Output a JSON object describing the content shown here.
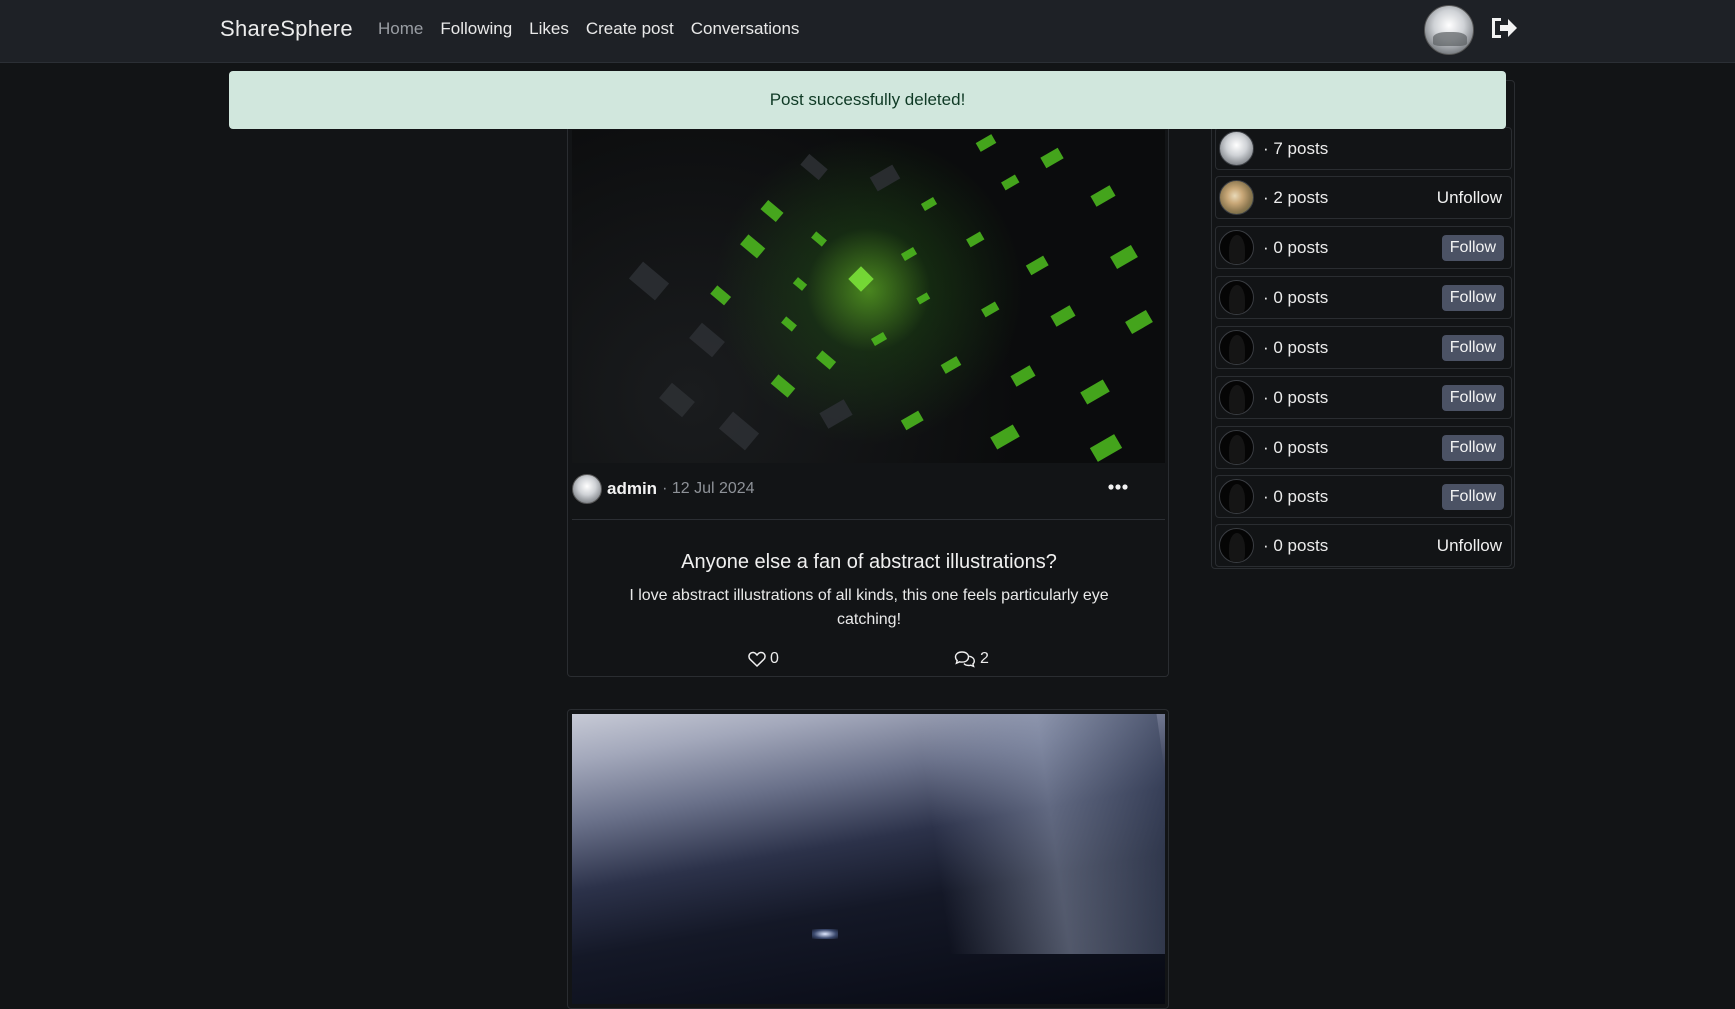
{
  "navbar": {
    "brand": "ShareSphere",
    "links": [
      {
        "label": "Home",
        "active": true
      },
      {
        "label": "Following"
      },
      {
        "label": "Likes"
      },
      {
        "label": "Create post"
      },
      {
        "label": "Conversations"
      }
    ],
    "user_avatar": "admin-avatar",
    "logout_icon": "sign-out-icon"
  },
  "alert": {
    "message": "Post successfully deleted!",
    "color": "#d1e7dd"
  },
  "posts": [
    {
      "image": "green-abstract-cubes",
      "author": "admin",
      "date": "· 12 Jul 2024",
      "title": "Anyone else a fan of abstract illustrations?",
      "body": "I love abstract illustrations of all kinds, this one feels particularly eye catching!",
      "likes": "0",
      "comments": "2"
    },
    {
      "image": "dark-blue-closeup"
    }
  ],
  "sidebar": {
    "users": [
      {
        "posts": "· 7 posts",
        "avatar": "admin",
        "action": ""
      },
      {
        "posts": "· 2 posts",
        "avatar": "cat",
        "action": "Unfollow"
      },
      {
        "posts": "· 0 posts",
        "avatar": "default",
        "action": "Follow"
      },
      {
        "posts": "· 0 posts",
        "avatar": "default",
        "action": "Follow"
      },
      {
        "posts": "· 0 posts",
        "avatar": "default",
        "action": "Follow"
      },
      {
        "posts": "· 0 posts",
        "avatar": "default",
        "action": "Follow"
      },
      {
        "posts": "· 0 posts",
        "avatar": "default",
        "action": "Follow"
      },
      {
        "posts": "· 0 posts",
        "avatar": "default",
        "action": "Follow"
      },
      {
        "posts": "· 0 posts",
        "avatar": "default",
        "action": "Unfollow"
      }
    ]
  },
  "colors": {
    "background": "#121416",
    "navbar": "#1e2126",
    "follow_button": "#4b5264"
  }
}
